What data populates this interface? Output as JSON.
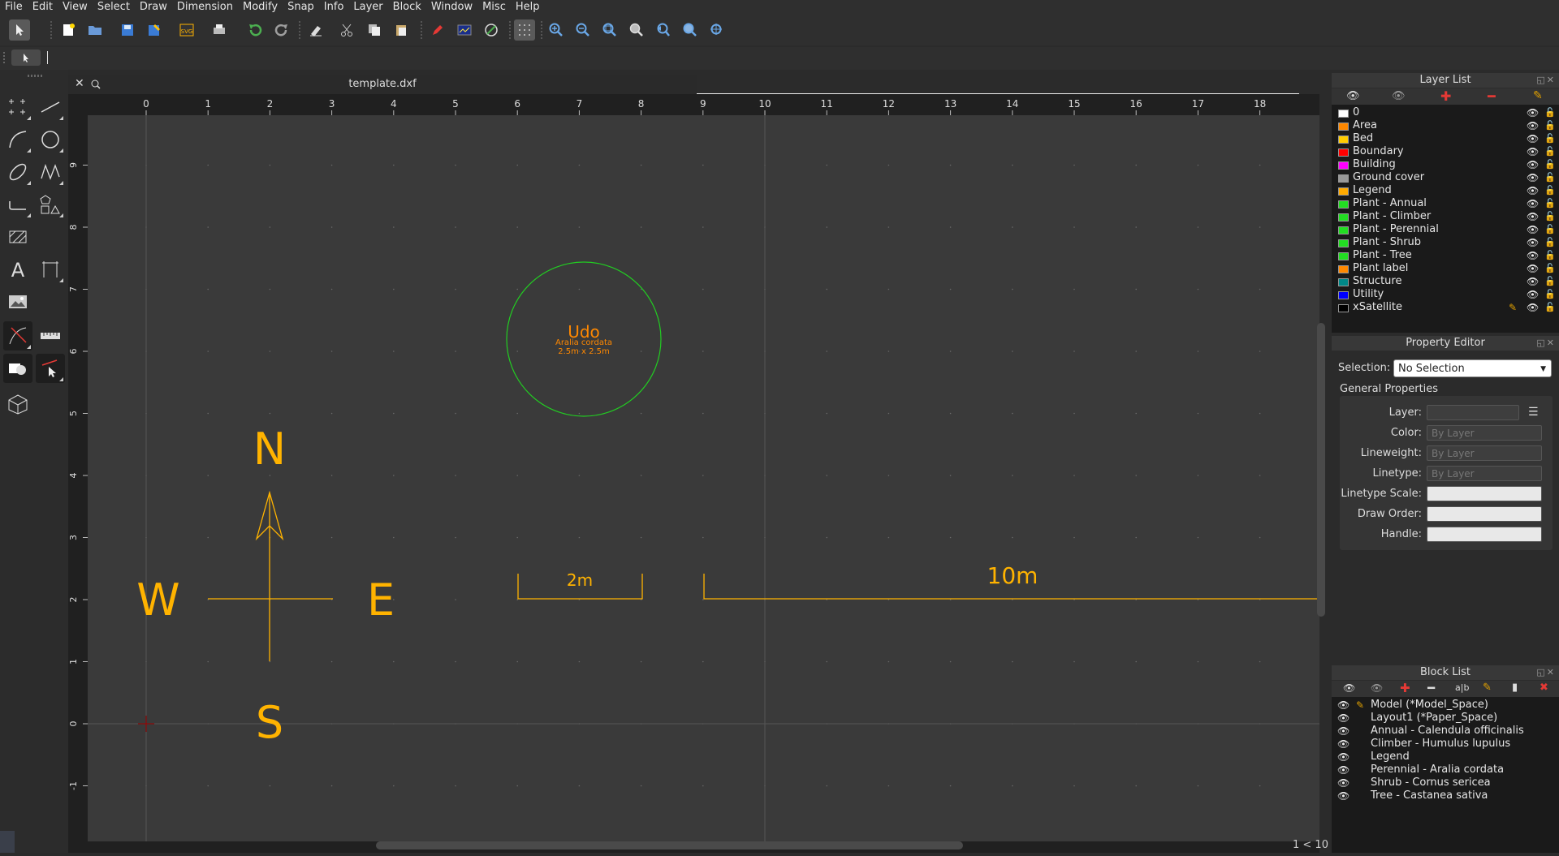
{
  "menu": [
    "File",
    "Edit",
    "View",
    "Select",
    "Draw",
    "Dimension",
    "Modify",
    "Snap",
    "Info",
    "Layer",
    "Block",
    "Window",
    "Misc",
    "Help"
  ],
  "toolbar_icons": [
    "select-pointer-icon",
    "new-document-icon",
    "open-folder-icon",
    "save-icon",
    "save-as-icon",
    "export-svg-icon",
    "print-icon",
    "undo-icon",
    "redo-icon",
    "erase-icon",
    "cut-icon",
    "copy-icon",
    "paste-icon",
    "pen-icon",
    "blue-screen-icon",
    "snap-circle-icon",
    "grid-icon",
    "zoom-in-icon",
    "zoom-out-icon",
    "zoom-auto-icon",
    "zoom-window-icon",
    "zoom-previous-icon",
    "zoom-redraw-icon",
    "zoom-pan-icon"
  ],
  "toolbar_svg_label": "SVG",
  "document": {
    "tab_title": "template.dxf"
  },
  "ruler": {
    "x_ticks": [
      "0",
      "1",
      "2",
      "3",
      "4",
      "5",
      "6",
      "7",
      "8",
      "9",
      "10",
      "11",
      "12",
      "13",
      "14",
      "15",
      "16",
      "17",
      "18"
    ],
    "y_ticks": [
      "9",
      "8",
      "7",
      "6",
      "5",
      "4",
      "3",
      "2",
      "1",
      "0",
      "-1"
    ]
  },
  "drawing": {
    "compass": {
      "n": "N",
      "s": "S",
      "e": "E",
      "w": "W"
    },
    "plant": {
      "name": "Udo",
      "species": "Aralia cordata",
      "size": "2.5m x 2.5m"
    },
    "scale_2m": "2m",
    "scale_10m": "10m",
    "colors": {
      "plant_circle": "#22cc22",
      "label": "#ff8800",
      "legend": "#ffb300",
      "canvas": "#3a3a3a"
    }
  },
  "status": {
    "scale": "1 < 10"
  },
  "layer_list": {
    "title": "Layer List",
    "layers": [
      {
        "name": "0",
        "color": "#ffffff"
      },
      {
        "name": "Area",
        "color": "#ff8800"
      },
      {
        "name": "Bed",
        "color": "#ffcc00"
      },
      {
        "name": "Boundary",
        "color": "#ff0000"
      },
      {
        "name": "Building",
        "color": "#ff00ff"
      },
      {
        "name": "Ground cover",
        "color": "#999999"
      },
      {
        "name": "Legend",
        "color": "#ffaa00"
      },
      {
        "name": "Plant - Annual",
        "color": "#22dd22"
      },
      {
        "name": "Plant - Climber",
        "color": "#22dd22"
      },
      {
        "name": "Plant - Perennial",
        "color": "#22dd22"
      },
      {
        "name": "Plant - Shrub",
        "color": "#22dd22"
      },
      {
        "name": "Plant - Tree",
        "color": "#22dd22"
      },
      {
        "name": "Plant label",
        "color": "#ff8800"
      },
      {
        "name": "Structure",
        "color": "#008888"
      },
      {
        "name": "Utility",
        "color": "#0000ff"
      },
      {
        "name": "xSatellite",
        "color": "#000000"
      }
    ]
  },
  "property_editor": {
    "title": "Property Editor",
    "selection_label": "Selection:",
    "selection_value": "No Selection",
    "group_title": "General Properties",
    "fields": [
      {
        "label": "Layer:",
        "value": ""
      },
      {
        "label": "Color:",
        "value": "By Layer"
      },
      {
        "label": "Lineweight:",
        "value": "By Layer"
      },
      {
        "label": "Linetype:",
        "value": "By Layer"
      },
      {
        "label": "Linetype Scale:",
        "value": ""
      },
      {
        "label": "Draw Order:",
        "value": ""
      },
      {
        "label": "Handle:",
        "value": ""
      }
    ]
  },
  "block_list": {
    "title": "Block List",
    "blocks": [
      "Model (*Model_Space)",
      "Layout1 (*Paper_Space)",
      "Annual - Calendula officinalis",
      "Climber - Humulus lupulus",
      "Legend",
      "Perennial - Aralia cordata",
      "Shrub - Cornus sericea",
      "Tree - Castanea sativa"
    ]
  }
}
